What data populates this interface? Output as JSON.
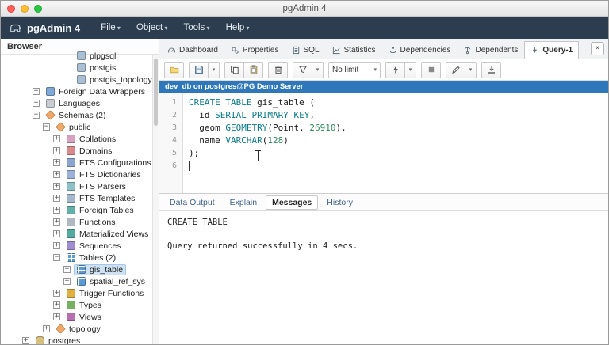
{
  "theme": {
    "header_bg": "#2b3d4f",
    "connection_bg": "#2e77bb",
    "keyword_color": "#0b7e8c",
    "selection_bg": "#cfe2f3"
  },
  "window": {
    "title": "pgAdmin 4"
  },
  "appbar": {
    "brand": "pgAdmin 4",
    "menus": [
      {
        "label": "File"
      },
      {
        "label": "Object"
      },
      {
        "label": "Tools"
      },
      {
        "label": "Help"
      }
    ]
  },
  "browser": {
    "title": "Browser",
    "tree": [
      {
        "label": "plpgsql",
        "level": 5,
        "icon": "extension",
        "expander": null
      },
      {
        "label": "postgis",
        "level": 5,
        "icon": "extension",
        "expander": null
      },
      {
        "label": "postgis_topology",
        "level": 5,
        "icon": "extension",
        "expander": null
      },
      {
        "label": "Foreign Data Wrappers",
        "level": 2,
        "icon": "fdw",
        "expander": "plus"
      },
      {
        "label": "Languages",
        "level": 2,
        "icon": "languages",
        "expander": "plus"
      },
      {
        "label": "Schemas (2)",
        "level": 2,
        "icon": "schemas",
        "expander": "minus"
      },
      {
        "label": "public",
        "level": 3,
        "icon": "schema",
        "expander": "minus"
      },
      {
        "label": "Collations",
        "level": 4,
        "icon": "collations",
        "expander": "plus"
      },
      {
        "label": "Domains",
        "level": 4,
        "icon": "domains",
        "expander": "plus"
      },
      {
        "label": "FTS Configurations",
        "level": 4,
        "icon": "fts-config",
        "expander": "plus"
      },
      {
        "label": "FTS Dictionaries",
        "level": 4,
        "icon": "fts-dict",
        "expander": "plus"
      },
      {
        "label": "FTS Parsers",
        "level": 4,
        "icon": "fts-parser",
        "expander": "plus"
      },
      {
        "label": "FTS Templates",
        "level": 4,
        "icon": "fts-template",
        "expander": "plus"
      },
      {
        "label": "Foreign Tables",
        "level": 4,
        "icon": "foreign-table",
        "expander": "plus"
      },
      {
        "label": "Functions",
        "level": 4,
        "icon": "functions",
        "expander": "plus"
      },
      {
        "label": "Materialized Views",
        "level": 4,
        "icon": "mat-views",
        "expander": "plus"
      },
      {
        "label": "Sequences",
        "level": 4,
        "icon": "sequences",
        "expander": "plus"
      },
      {
        "label": "Tables (2)",
        "level": 4,
        "icon": "tables",
        "expander": "minus"
      },
      {
        "label": "gis_table",
        "level": 5,
        "icon": "table",
        "expander": "plus",
        "selected": true
      },
      {
        "label": "spatial_ref_sys",
        "level": 5,
        "icon": "table",
        "expander": "plus"
      },
      {
        "label": "Trigger Functions",
        "level": 4,
        "icon": "trigger-fn",
        "expander": "plus"
      },
      {
        "label": "Types",
        "level": 4,
        "icon": "types",
        "expander": "plus"
      },
      {
        "label": "Views",
        "level": 4,
        "icon": "views",
        "expander": "plus"
      },
      {
        "label": "topology",
        "level": 3,
        "icon": "schema",
        "expander": "plus"
      },
      {
        "label": "postgres",
        "level": 1,
        "icon": "database",
        "expander": "plus"
      }
    ]
  },
  "tabs": {
    "items": [
      {
        "label": "Dashboard",
        "icon": "gauge"
      },
      {
        "label": "Properties",
        "icon": "gears"
      },
      {
        "label": "SQL",
        "icon": "sql-file"
      },
      {
        "label": "Statistics",
        "icon": "chart"
      },
      {
        "label": "Dependencies",
        "icon": "dependencies"
      },
      {
        "label": "Dependents",
        "icon": "dependents"
      },
      {
        "label": "Query-1",
        "icon": "bolt",
        "active": true
      }
    ]
  },
  "toolbar": {
    "groups": [
      [
        {
          "name": "open-file",
          "icon": "folder"
        }
      ],
      [
        {
          "name": "save",
          "icon": "floppy"
        },
        {
          "name": "save-options",
          "caret": true
        }
      ],
      [
        {
          "name": "copy",
          "icon": "copy"
        },
        {
          "name": "paste",
          "icon": "paste"
        }
      ],
      [
        {
          "name": "delete-drop",
          "icon": "trash"
        }
      ],
      [
        {
          "name": "filter",
          "icon": "funnel"
        },
        {
          "name": "filter-options",
          "caret": true
        }
      ],
      [
        {
          "name": "row-limit",
          "select": true,
          "value": "No limit"
        }
      ],
      [
        {
          "name": "execute-query",
          "icon": "bolt"
        },
        {
          "name": "execute-options",
          "caret": true
        }
      ],
      [
        {
          "name": "stop-query",
          "icon": "stop"
        }
      ],
      [
        {
          "name": "edit",
          "icon": "pencil"
        },
        {
          "name": "edit-options",
          "caret": true
        }
      ],
      [
        {
          "name": "download-results",
          "icon": "download"
        }
      ]
    ]
  },
  "query": {
    "connection": "dev_db on postgres@PG Demo Server"
  },
  "editor": {
    "lines": [
      "CREATE TABLE gis_table (",
      "  id SERIAL PRIMARY KEY,",
      "  geom GEOMETRY(Point, 26910),",
      "  name VARCHAR(128)",
      ");",
      ""
    ],
    "keywords": [
      "CREATE",
      "TABLE",
      "SERIAL",
      "PRIMARY",
      "KEY",
      "GEOMETRY",
      "VARCHAR"
    ],
    "caret_line": 6
  },
  "output": {
    "tabs": [
      {
        "label": "Data Output"
      },
      {
        "label": "Explain"
      },
      {
        "label": "Messages",
        "active": true
      },
      {
        "label": "History"
      }
    ],
    "lines": [
      "CREATE TABLE",
      "",
      "Query returned successfully in 4 secs."
    ]
  }
}
